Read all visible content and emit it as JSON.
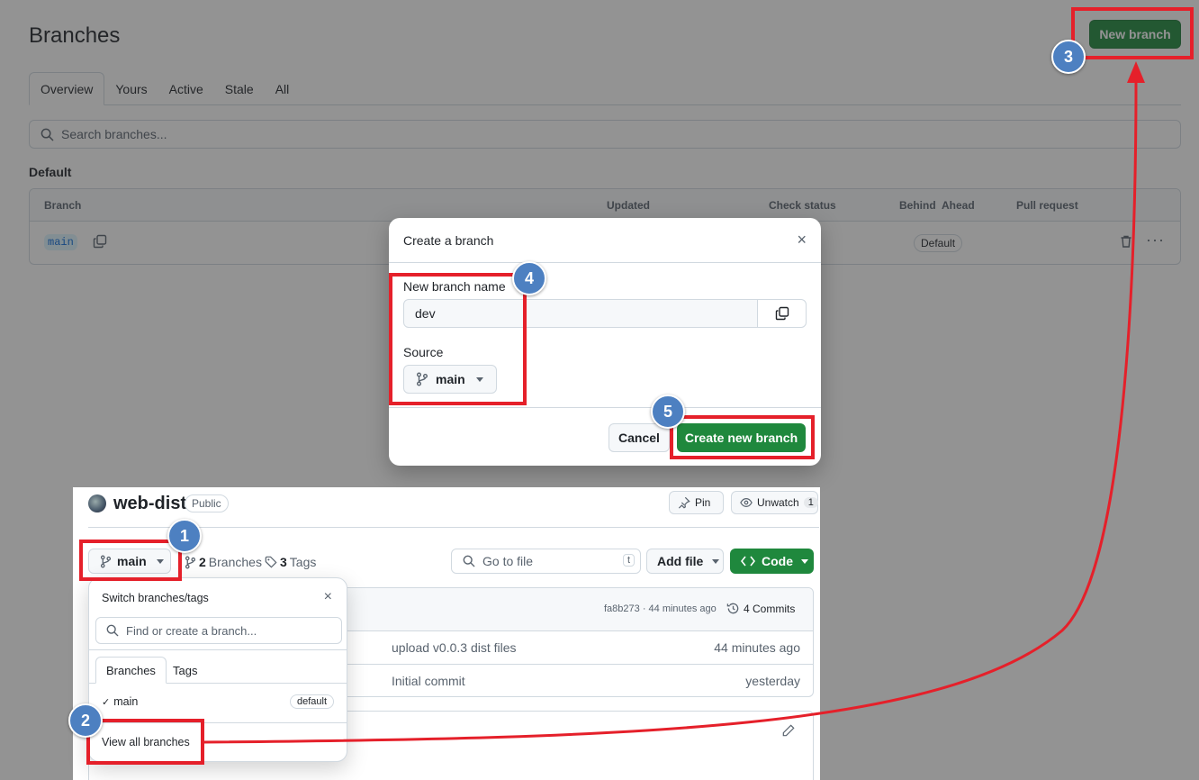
{
  "branches_page": {
    "title": "Branches",
    "new_branch_label": "New branch",
    "tabs": [
      {
        "label": "Overview"
      },
      {
        "label": "Yours"
      },
      {
        "label": "Active"
      },
      {
        "label": "Stale"
      },
      {
        "label": "All"
      }
    ],
    "search_placeholder": "Search branches...",
    "section_title": "Default",
    "table": {
      "headers": {
        "branch": "Branch",
        "updated": "Updated",
        "check_status": "Check status",
        "behind": "Behind",
        "ahead": "Ahead",
        "pull_request": "Pull request"
      },
      "row": {
        "branch": "main",
        "badge": "Default"
      }
    }
  },
  "modal": {
    "title": "Create a branch",
    "close_glyph": "×",
    "name_label": "New branch name",
    "name_value": "dev",
    "source_label": "Source",
    "source_value": "main",
    "cancel_label": "Cancel",
    "create_label": "Create new branch"
  },
  "repo": {
    "name": "web-dist",
    "visibility": "Public",
    "pin_label": "Pin",
    "unwatch_label": "Unwatch",
    "watch_count": "1",
    "branch_label": "main",
    "branches_count": "2",
    "branches_text": "Branches",
    "tags_count": "3",
    "tags_text": "Tags",
    "goto_placeholder": "Go to file",
    "goto_shortcut": "t",
    "add_file_label": "Add file",
    "code_label": "Code",
    "commit_hash": "fa8b273 · 44 minutes ago",
    "commits_label": "4 Commits",
    "files": [
      {
        "message": "upload v0.0.3 dist files",
        "time": "44 minutes ago"
      },
      {
        "message": "Initial commit",
        "time": "yesterday"
      }
    ]
  },
  "dropdown": {
    "title": "Switch branches/tags",
    "close_glyph": "×",
    "search_placeholder": "Find or create a branch...",
    "tabs": [
      {
        "label": "Branches"
      },
      {
        "label": "Tags"
      }
    ],
    "item": {
      "check": "✓",
      "label": "main",
      "badge": "default"
    },
    "view_all_label": "View all branches"
  },
  "steps": [
    "1",
    "2",
    "3",
    "4",
    "5"
  ],
  "colors": {
    "primary_green": "#1f883d",
    "annotation_red": "#e5202a",
    "step_blue": "#4d80c1",
    "border": "#d1d9e0"
  }
}
